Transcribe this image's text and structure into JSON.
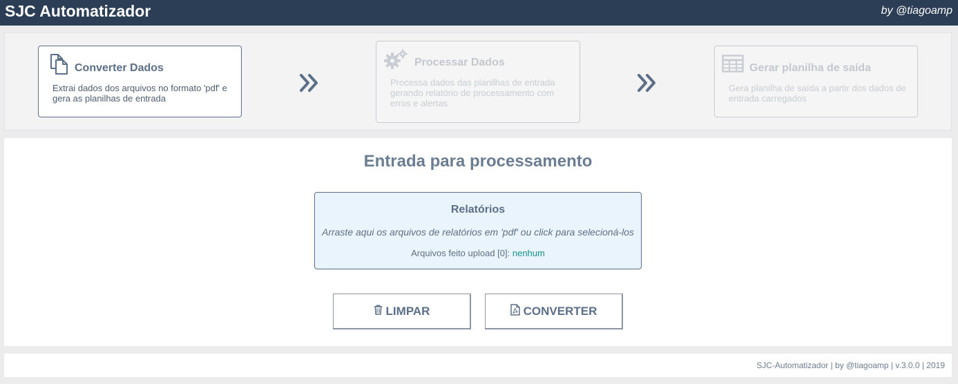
{
  "header": {
    "title": "SJC Automatizador",
    "byline": "by @tiagoamp"
  },
  "steps": [
    {
      "icon": "copy-documents-icon",
      "title": "Converter Dados",
      "description": "Extrai dados dos arquivos no formato 'pdf' e gera as planilhas de entrada",
      "state": "active"
    },
    {
      "icon": "gears-icon",
      "title": "Processar Dados",
      "description": "Processa dados das planilhas de entrada gerando relatório de processamento com erros e alertas",
      "state": "disabled"
    },
    {
      "icon": "table-icon",
      "title": "Gerar planilha de saída",
      "description": "Gera planilha de saída a partir dos dados de entrada carregados",
      "state": "disabled"
    }
  ],
  "main": {
    "section_title": "Entrada para processamento",
    "dropzone": {
      "title": "Relatórios",
      "hint": "Arraste aqui os arquivos de relatórios em 'pdf' ou click para selecioná-los",
      "uploaded_label": "Arquivos feito upload [0]:",
      "uploaded_value": "nenhum"
    },
    "buttons": {
      "clear_label": "LIMPAR",
      "clear_icon": "trash-icon",
      "convert_label": "CONVERTER",
      "convert_icon": "pdf-file-icon"
    }
  },
  "footer": {
    "text": "SJC-Automatizador | by @tiagoamp | v.3.0.0 | 2019"
  },
  "colors": {
    "topbar": "#2c3e55",
    "accent": "#5b6f88",
    "dropzone_bg": "#eaf4fd",
    "link_teal": "#14918f"
  }
}
